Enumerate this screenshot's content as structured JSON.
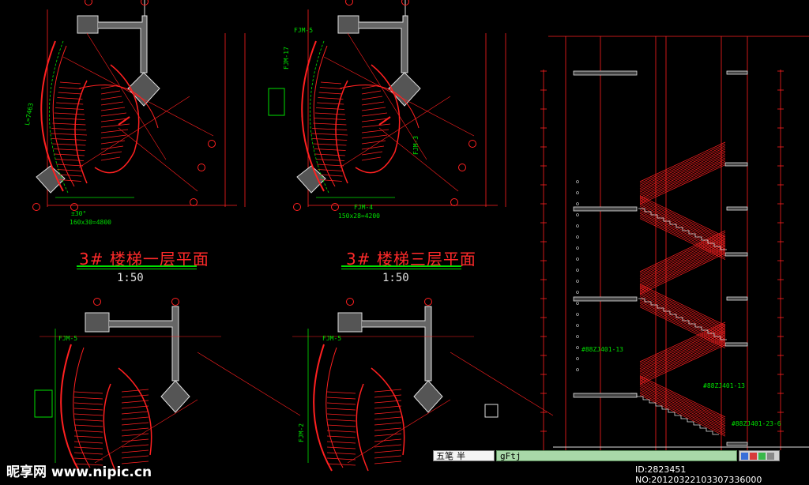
{
  "plans": [
    {
      "title": "3# 楼梯一层平面",
      "scale": "1:50"
    },
    {
      "title": "3# 楼梯三层平面",
      "scale": "1:50"
    }
  ],
  "notes": {
    "length": "L=7463",
    "angle1": "±30°",
    "steps1": "160x30=4800",
    "steps2": "150x28=4200",
    "door1": "FJM-5",
    "door2": "FJM-17",
    "door3": "FJM-4",
    "door4": "FJM-3",
    "door5": "FJM-2",
    "ref1": "#88ZJ401-13",
    "ref2": "#88ZJ401-13",
    "ref3": "#88ZJ401-23-6"
  },
  "ime": {
    "label1": "五笔",
    "label2": "半"
  },
  "command": {
    "text": "gFtj"
  },
  "watermark": {
    "site": "昵享网 www.nipic.cn",
    "id": "ID:2823451 NO:20120322103307336000"
  },
  "colors": {
    "background": "#000000",
    "red": "#ff2020",
    "green": "#00e000",
    "white": "#e0e0e0"
  }
}
